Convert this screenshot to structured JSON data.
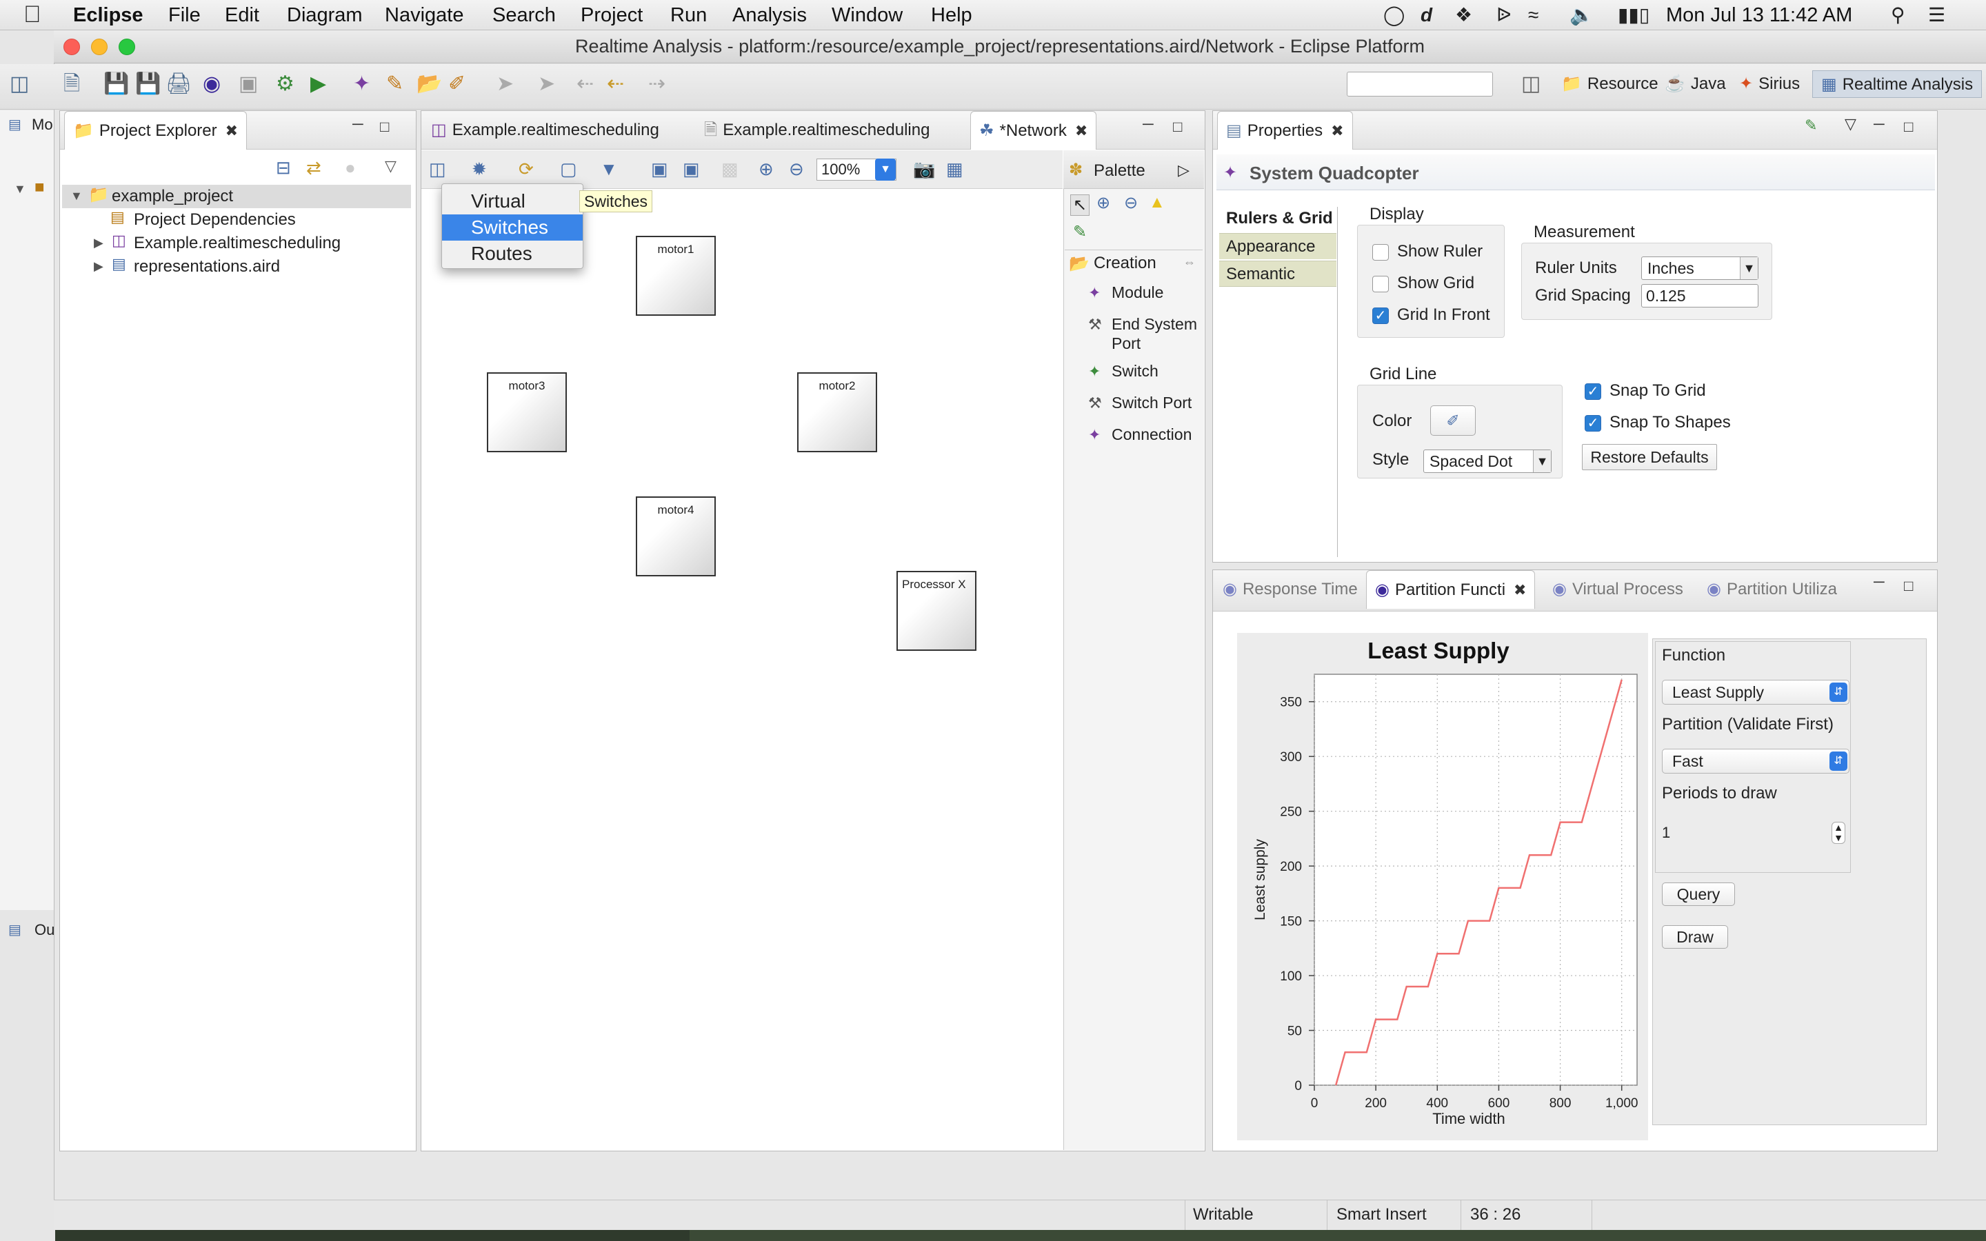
{
  "menubar": {
    "app": "Eclipse",
    "items": [
      "File",
      "Edit",
      "Diagram",
      "Navigate",
      "Search",
      "Project",
      "Run",
      "Analysis",
      "Window",
      "Help"
    ],
    "clock": "Mon Jul 13  11:42 AM"
  },
  "window": {
    "title": "Realtime Analysis - platform:/resource/example_project/representations.aird/Network - Eclipse Platform"
  },
  "perspectives": [
    {
      "label": "Resource",
      "active": false
    },
    {
      "label": "Java",
      "active": false
    },
    {
      "label": "Sirius",
      "active": false
    },
    {
      "label": "Realtime Analysis",
      "active": true
    }
  ],
  "left_clip": {
    "tab_a": "Mo",
    "tab_b": "Ou"
  },
  "project_explorer": {
    "title": "Project Explorer",
    "tree": [
      {
        "label": "example_project",
        "level": 0,
        "expanded": true
      },
      {
        "label": "Project Dependencies",
        "level": 1
      },
      {
        "label": "Example.realtimescheduling",
        "level": 1,
        "expandable": true
      },
      {
        "label": "representations.aird",
        "level": 1,
        "expandable": true
      }
    ]
  },
  "editor": {
    "tabs": [
      "Example.realtimescheduling",
      "Example.realtimescheduling",
      "*Network"
    ],
    "active_tab": "*Network",
    "zoom": "100%",
    "dropdown": {
      "items": [
        "Virtual",
        "Switches",
        "Routes"
      ],
      "selected": "Switches"
    },
    "tooltip": "Switches",
    "nodes": [
      "motor1",
      "motor3",
      "motor2",
      "motor4",
      "Processor X"
    ]
  },
  "palette": {
    "title": "Palette",
    "drawer": "Creation",
    "items": [
      "Module",
      "End System Port",
      "Switch",
      "Switch Port",
      "Connection"
    ]
  },
  "properties": {
    "title": "Properties",
    "header": "System Quadcopter",
    "tabs": [
      "Rulers & Grid",
      "Appearance",
      "Semantic"
    ],
    "active_tab": "Rulers & Grid",
    "display": {
      "label": "Display",
      "show_ruler": {
        "label": "Show Ruler",
        "checked": false
      },
      "show_grid": {
        "label": "Show Grid",
        "checked": false
      },
      "grid_in_front": {
        "label": "Grid In Front",
        "checked": true
      }
    },
    "measurement": {
      "label": "Measurement",
      "ruler_units_label": "Ruler Units",
      "ruler_units": "Inches",
      "grid_spacing_label": "Grid Spacing",
      "grid_spacing": "0.125"
    },
    "grid_line": {
      "label": "Grid Line",
      "color_label": "Color",
      "style_label": "Style",
      "style": "Spaced Dot"
    },
    "snap_to_grid": {
      "label": "Snap To Grid",
      "checked": true
    },
    "snap_to_shapes": {
      "label": "Snap To Shapes",
      "checked": true
    },
    "restore_defaults": "Restore Defaults"
  },
  "analysis": {
    "tabs": [
      "Response Time",
      "Partition Functi",
      "Virtual Process",
      "Partition Utiliza"
    ],
    "active_tab": "Partition Functi",
    "function_label": "Function",
    "function": "Least Supply",
    "partition_label": "Partition (Validate First)",
    "partition": "Fast",
    "periods_label": "Periods to draw",
    "periods": "1",
    "query": "Query",
    "draw": "Draw"
  },
  "chart_data": {
    "type": "line",
    "title": "Least Supply",
    "xlabel": "Time width",
    "ylabel": "Least supply",
    "xlim": [
      0,
      1050
    ],
    "ylim": [
      0,
      375
    ],
    "xticks": [
      "0",
      "200",
      "400",
      "600",
      "800",
      "1,000"
    ],
    "yticks": [
      "0",
      "50",
      "100",
      "150",
      "200",
      "250",
      "300",
      "350"
    ],
    "grid": true,
    "series": [
      {
        "color": "#f07070",
        "x": [
          70,
          100,
          140,
          170,
          200,
          240,
          270,
          300,
          340,
          370,
          400,
          440,
          470,
          500,
          540,
          570,
          600,
          640,
          670,
          700,
          740,
          770,
          800,
          840,
          870,
          900,
          1000
        ],
        "y": [
          0,
          30,
          30,
          30,
          60,
          60,
          60,
          90,
          90,
          90,
          120,
          120,
          120,
          150,
          150,
          150,
          180,
          180,
          180,
          210,
          210,
          210,
          240,
          240,
          240,
          270,
          370
        ]
      }
    ]
  },
  "status": {
    "writable": "Writable",
    "insert": "Smart Insert",
    "position": "36 : 26"
  }
}
